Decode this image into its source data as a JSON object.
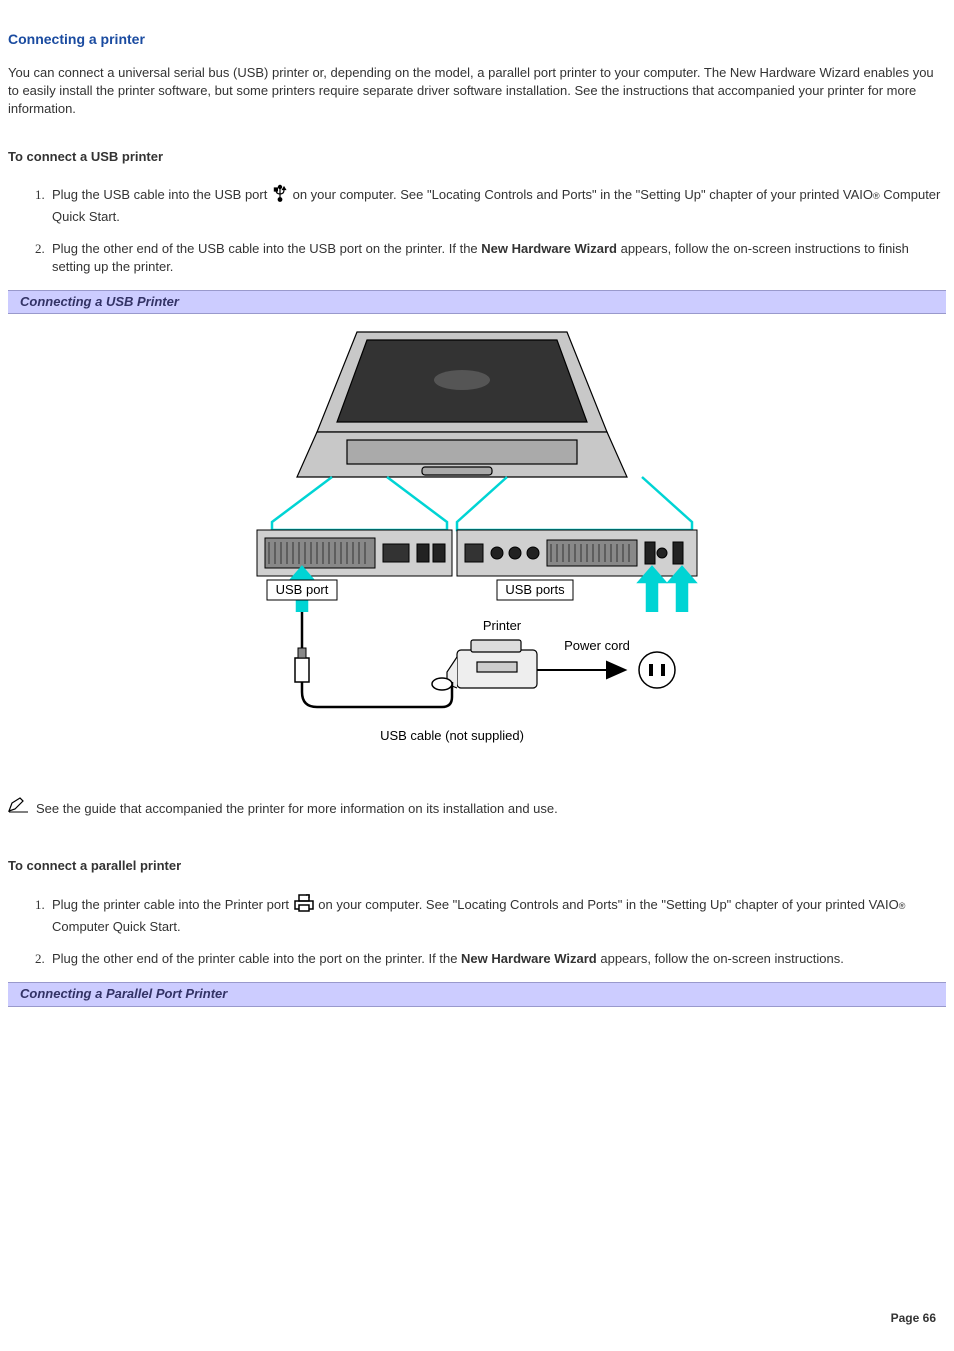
{
  "title": "Connecting a printer",
  "intro": "You can connect a universal serial bus (USB) printer or, depending on the model, a parallel port printer to your computer. The New Hardware Wizard enables you to easily install the printer software, but some printers require separate driver software installation. See the instructions that accompanied your printer for more information.",
  "usb": {
    "heading": "To connect a USB printer",
    "step1_pre": "Plug the USB cable into the USB port ",
    "step1_post": " on your computer. See \"Locating Controls and Ports\" in the \"Setting Up\" chapter of your printed VAIO",
    "step1_tail": " Computer Quick Start.",
    "step2_pre": "Plug the other end of the USB cable into the USB port on the printer. If the ",
    "step2_bold": "New Hardware Wizard",
    "step2_post": " appears, follow the on-screen instructions to finish setting up the printer.",
    "caption": "Connecting a USB Printer",
    "fig": {
      "usb_port": "USB port",
      "usb_ports": "USB ports",
      "printer": "Printer",
      "power_cord": "Power cord",
      "cable": "USB cable (not supplied)"
    }
  },
  "note": "See the guide that accompanied the printer for more information on its installation and use.",
  "parallel": {
    "heading": "To connect a parallel printer",
    "step1_pre": "Plug the printer cable into the Printer port ",
    "step1_post": " on your computer. See \"Locating Controls and Ports\" in the \"Setting Up\" chapter of your printed VAIO",
    "step1_tail": " Computer Quick Start.",
    "step2_pre": "Plug the other end of the printer cable into the port on the printer. If the ",
    "step2_bold": "New Hardware Wizard",
    "step2_post": " appears, follow the on-screen instructions.",
    "caption": "Connecting a Parallel Port Printer"
  },
  "reg": "®",
  "page": "Page 66"
}
